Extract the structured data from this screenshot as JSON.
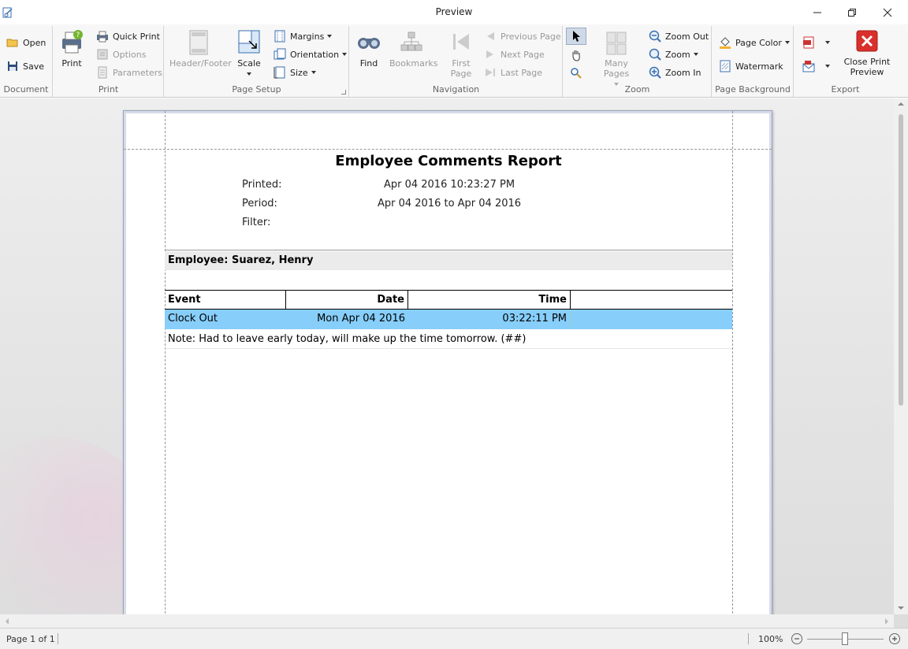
{
  "window": {
    "title": "Preview"
  },
  "ribbon": {
    "document": {
      "group_label": "Document",
      "open": "Open",
      "save": "Save"
    },
    "print": {
      "group_label": "Print",
      "print": "Print",
      "quick_print": "Quick Print",
      "options": "Options",
      "parameters": "Parameters"
    },
    "page_setup": {
      "group_label": "Page Setup",
      "header_footer": "Header/Footer",
      "scale": "Scale",
      "margins": "Margins",
      "orientation": "Orientation",
      "size": "Size"
    },
    "navigation": {
      "group_label": "Navigation",
      "find": "Find",
      "bookmarks": "Bookmarks",
      "first_page_line1": "First",
      "first_page_line2": "Page",
      "previous_page": "Previous Page",
      "next_page": "Next Page",
      "last_page": "Last Page"
    },
    "zoom": {
      "group_label": "Zoom",
      "many_pages": "Many Pages",
      "zoom_out": "Zoom Out",
      "zoom": "Zoom",
      "zoom_in": "Zoom In"
    },
    "page_background": {
      "group_label": "Page Background",
      "page_color": "Page Color",
      "watermark": "Watermark"
    },
    "export": {
      "group_label": "Export",
      "close_line1": "Close Print",
      "close_line2": "Preview"
    }
  },
  "report": {
    "title": "Employee Comments Report",
    "printed_label": "Printed:",
    "printed_value": "Apr 04 2016 10:23:27 PM",
    "period_label": "Period:",
    "period_value": "Apr 04 2016 to Apr 04 2016",
    "filter_label": "Filter:",
    "employee": "Employee: Suarez, Henry",
    "columns": {
      "event": "Event",
      "date": "Date",
      "time": "Time"
    },
    "row": {
      "event": "Clock Out",
      "date": "Mon Apr 04 2016",
      "time": "03:22:11 PM"
    },
    "note": "Note: Had to leave early today, will make up the time tomorrow. (##)"
  },
  "status": {
    "page_info": "Page 1 of 1",
    "zoom": "100%",
    "zoom_level_percent": 100
  },
  "colors": {
    "highlight_row": "#87cefa",
    "employee_band": "#ebebeb",
    "accent_red": "#d9302c"
  }
}
